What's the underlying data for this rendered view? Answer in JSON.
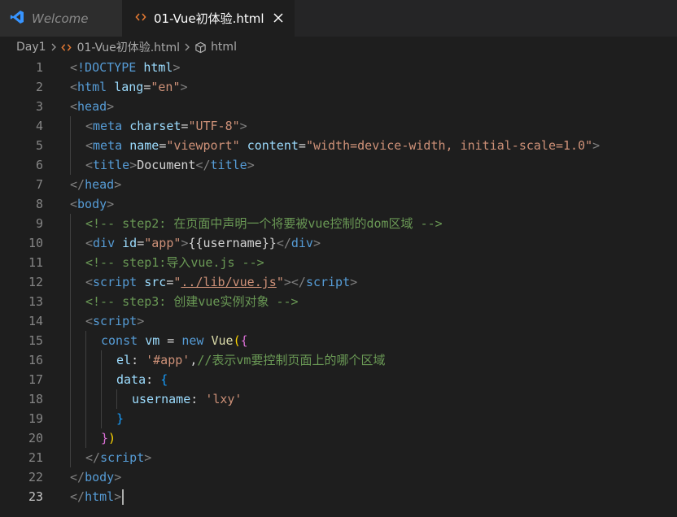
{
  "tabs": [
    {
      "label": "Welcome",
      "icon": "vscode-icon"
    },
    {
      "label": "01-Vue初体验.html",
      "icon": "html-file-icon",
      "active": true
    }
  ],
  "breadcrumb": {
    "folder": "Day1",
    "file": "01-Vue初体验.html",
    "symbol": "html"
  },
  "colors": {
    "editor_bg": "#1e1e1e",
    "tab_bar_bg": "#252526",
    "tag": "#569cd6",
    "attribute": "#9cdcfe",
    "string": "#ce9178",
    "comment": "#6a9955",
    "punctuation": "#808080",
    "html_icon": "#e37933",
    "vscode_icon": "#3794ff"
  },
  "editor": {
    "current_line": 23,
    "lines": [
      {
        "n": "1"
      },
      {
        "n": "2"
      },
      {
        "n": "3"
      },
      {
        "n": "4"
      },
      {
        "n": "5"
      },
      {
        "n": "6"
      },
      {
        "n": "7"
      },
      {
        "n": "8"
      },
      {
        "n": "9"
      },
      {
        "n": "10"
      },
      {
        "n": "11"
      },
      {
        "n": "12"
      },
      {
        "n": "13"
      },
      {
        "n": "14"
      },
      {
        "n": "15"
      },
      {
        "n": "16"
      },
      {
        "n": "17"
      },
      {
        "n": "18"
      },
      {
        "n": "19"
      },
      {
        "n": "20"
      },
      {
        "n": "21"
      },
      {
        "n": "22"
      },
      {
        "n": "23"
      }
    ],
    "tokens": {
      "lt": "<",
      "gt": ">",
      "lts": "</",
      "eq": "=",
      "q": "\"",
      "doctype": "!DOCTYPE",
      "html": "html",
      "lang": "lang",
      "en": "en",
      "head": "head",
      "meta": "meta",
      "charset": "charset",
      "utf8": "UTF-8",
      "name": "name",
      "viewport": "viewport",
      "content": "content",
      "content_val": "width=device-width, initial-scale=1.0",
      "title": "title",
      "document": "Document",
      "body": "body",
      "comment_step2": "<!-- step2: 在页面中声明一个将要被vue控制的dom区域 -->",
      "div": "div",
      "id": "id",
      "app": "app",
      "username_tpl": "{{username}}",
      "comment_step1": "<!-- step1:导入vue.js -->",
      "script": "script",
      "src": "src",
      "src_val": "../lib/vue.js",
      "comment_step3": "<!-- step3: 创建vue实例对象 -->",
      "const": "const",
      "vm": "vm",
      "new": "new",
      "Vue": "Vue",
      "paren_open": "(",
      "brace_open": "{",
      "brace_close": "}",
      "paren_close": ")",
      "el": "el",
      "colon": ":",
      "sp": " ",
      "el_val": "'#app'",
      "comma": ",",
      "comment_js": "//表示vm要控制页面上的哪个区域",
      "data": "data",
      "username": "username",
      "lxy": "'lxy'"
    }
  }
}
